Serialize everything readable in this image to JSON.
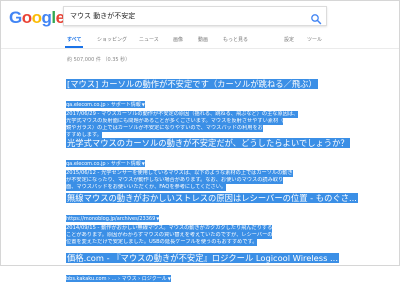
{
  "logo": {
    "letters": [
      {
        "ch": "G",
        "color": "#4285f4"
      },
      {
        "ch": "o",
        "color": "#ea4335"
      },
      {
        "ch": "o",
        "color": "#fbbc05"
      },
      {
        "ch": "g",
        "color": "#4285f4"
      },
      {
        "ch": "l",
        "color": "#34a853"
      },
      {
        "ch": "e",
        "color": "#ea4335"
      }
    ]
  },
  "search": {
    "query": "マウス 動きが不安定"
  },
  "tabs": {
    "all": "すべて",
    "shopping": "ショッピング",
    "news": "ニュース",
    "images": "画像",
    "videos": "動画",
    "more": "もっと見る",
    "settings": "設定",
    "tools": "ツール"
  },
  "stats": "約 507,000 件 （0.35 秒）",
  "results": [
    {
      "title": "[マウス] カーソルの動作が不安定です（カーソルが跳ねる／飛ぶ）",
      "url": "qa.elecom.co.jp › サポート情報",
      "snippet": [
        "2017/06/29 - マウスカーソルの動作が不安定の原因（揺れる、跳ねる、飛ぶなど）の主な原因は、",
        "光学式マウスの反射面にも問題があることが多くございます。マウスを反射させやすい素材（",
        "鏡やガラス）の上ではカーソルが不安定になりやすいので、マウスパッドの利用をお",
        "すすめします。"
      ]
    },
    {
      "title": "光学式マウスのカーソルの動きが不安定だが、どうしたらよいでしょうか？",
      "url": "qa.elecom.co.jp › サポート情報",
      "snippet": [
        "2015/06/12 - 光学センサーを使用しているマウスは、以下のような素材の上ではカーソルの動き",
        "が不安定になったり、マウスが動作しない場合があります。なお、お使いのマウスの読み取り",
        "面、マウスパッドをお使いいただくか、FAQを参考にしてください。"
      ]
    },
    {
      "title": "無線マウスの動きがおかしいストレスの原因はレシーバーの位置 - ものぐさ...",
      "url": "https://monoblog.jp/archives/23369",
      "snippet": [
        "2014/09/15 - 動作がおかしい無線マウス。マウスの動きがカクカクしたり飛んだりする",
        "ことがあります。原因がわからずマウスの買い替えを考えていたのですが、レシーバーの",
        "位置を変えただけで安定しました。USBの延長ケーブルを使うのもおすすめです。"
      ]
    },
    {
      "title": "価格.com - 『マウスの動きが不安定』ロジクール Logicool Wireless ...",
      "url": "bbs.kakaku.com › ... › マウス › ロジクール",
      "snippet": []
    }
  ]
}
